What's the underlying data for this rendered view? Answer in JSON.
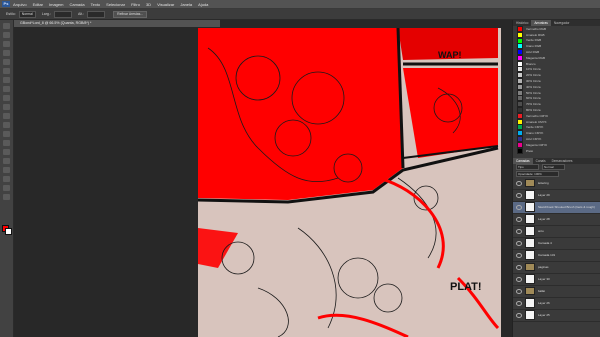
{
  "menubar": {
    "logo": "Ps",
    "items": [
      "Arquivo",
      "Editar",
      "Imagem",
      "Camada",
      "Texto",
      "Selecionar",
      "Filtro",
      "3D",
      "Visualizar",
      "Janela",
      "Ajuda"
    ]
  },
  "options": {
    "items": [
      "Estilo:",
      "Normal",
      "Larg.:",
      "Alt.:"
    ],
    "refine_button": "Refinar Arestas..."
  },
  "document": {
    "tab_title": "GBond*Lord_8 @ 66.5% (Quanta, RGB/8*) *"
  },
  "panels": {
    "top_tabs": [
      "Histórico",
      "Amostras",
      "Navegador"
    ],
    "swatches": [
      {
        "color": "#ff0000",
        "label": "Vermelho RGB"
      },
      {
        "color": "#ffff00",
        "label": "Amarelo RGB"
      },
      {
        "color": "#00ff00",
        "label": "Verde RGB"
      },
      {
        "color": "#00ffff",
        "label": "Ciano RGB"
      },
      {
        "color": "#0000ff",
        "label": "Azul RGB"
      },
      {
        "color": "#ff00ff",
        "label": "Magenta RGB"
      },
      {
        "color": "#ffffff",
        "label": "Branco"
      },
      {
        "color": "#e6e6e6",
        "label": "10% Cinza"
      },
      {
        "color": "#cccccc",
        "label": "20% Cinza"
      },
      {
        "color": "#b3b3b3",
        "label": "30% Cinza"
      },
      {
        "color": "#999999",
        "label": "40% Cinza"
      },
      {
        "color": "#808080",
        "label": "50% Cinza"
      },
      {
        "color": "#666666",
        "label": "60% Cinza"
      },
      {
        "color": "#4d4d4d",
        "label": "70% Cinza"
      },
      {
        "color": "#333333",
        "label": "80% Cinza"
      },
      {
        "color": "#ed1c24",
        "label": "Vermelho CMYK"
      },
      {
        "color": "#fff200",
        "label": "Amarelo CMYK"
      },
      {
        "color": "#00a651",
        "label": "Verde CMYK"
      },
      {
        "color": "#00aeef",
        "label": "Ciano CMYK"
      },
      {
        "color": "#2e3192",
        "label": "Azul CMYK"
      },
      {
        "color": "#ec008c",
        "label": "Magenta CMYK"
      },
      {
        "color": "#000000",
        "label": "Preto"
      }
    ],
    "layers_tabs": [
      "Camadas",
      "Canais",
      "Demarcadores"
    ],
    "layers_controls": [
      "Tipo",
      "Normal",
      "Opacidade: 100%"
    ],
    "layers": [
      {
        "name": "lettering",
        "type": "group",
        "selected": false
      },
      {
        "name": "Layer 29",
        "type": "layer",
        "selected": false
      },
      {
        "name": "Sketchbook Shouted Brush (Gets & rough)",
        "type": "text",
        "selected": true
      },
      {
        "name": "Layer 28",
        "type": "layer",
        "selected": false
      },
      {
        "name": "arco",
        "type": "layer",
        "selected": false
      },
      {
        "name": "Camada 4",
        "type": "layer",
        "selected": false
      },
      {
        "name": "Camada 131",
        "type": "layer",
        "selected": false
      },
      {
        "name": "paginas",
        "type": "group",
        "selected": false
      },
      {
        "name": "Layer 30",
        "type": "layer",
        "selected": false
      },
      {
        "name": "balão",
        "type": "group",
        "selected": false
      },
      {
        "name": "Layer 26",
        "type": "layer",
        "selected": false
      },
      {
        "name": "Layer 25",
        "type": "layer",
        "selected": false
      }
    ]
  },
  "colors": {
    "foreground": "#ff0000",
    "background": "#ffffff",
    "paint_red": "#ff0000",
    "paper": "#d8c4bd"
  },
  "art": {
    "sfx_1": "PLAT!",
    "sfx_2": "WAP!"
  }
}
